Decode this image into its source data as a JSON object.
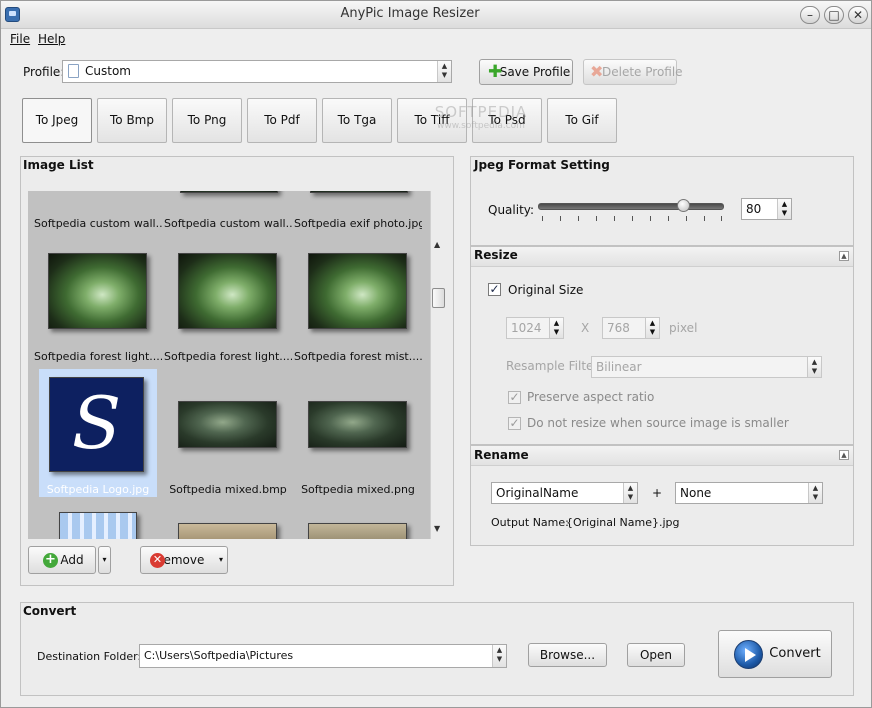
{
  "window": {
    "title": "AnyPic Image Resizer",
    "minimize": "–",
    "maximize": "□",
    "close": "✕"
  },
  "menu": {
    "file": "File",
    "help": "Help"
  },
  "profile": {
    "label": "Profile:",
    "value": "Custom",
    "save_label": "Save Profile",
    "delete_label": "Delete Profile"
  },
  "tabs": [
    "To Jpeg",
    "To Bmp",
    "To Png",
    "To Pdf",
    "To Tga",
    "To Tiff",
    "To Psd",
    "To Gif"
  ],
  "watermark": {
    "main": "SOFTPEDIA",
    "sub": "www.softpedia.com"
  },
  "image_list": {
    "title": "Image List",
    "rows": [
      [
        "Softpedia custom wall...",
        "Softpedia custom wall...",
        "Softpedia exif photo.jpg"
      ],
      [
        "Softpedia forest light....",
        "Softpedia forest light....",
        "Softpedia forest mist...."
      ],
      [
        "Softpedia Logo.jpg",
        "Softpedia mixed.bmp",
        "Softpedia mixed.png"
      ]
    ],
    "logo_letter": "S",
    "add_label": "Add",
    "remove_label": "Remove"
  },
  "jpeg": {
    "title": "Jpeg Format Setting",
    "quality_label": "Quality:",
    "quality_value": "80",
    "quality_fraction": 0.8
  },
  "resize": {
    "title": "Resize",
    "original_size_label": "Original Size",
    "width": "1024",
    "x_label": "X",
    "height": "768",
    "unit": "pixel",
    "filter_label": "Resample Filter:",
    "filter_value": "Bilinear",
    "preserve_label": "Preserve aspect ratio",
    "no_resize_label": "Do not resize when source image is smaller"
  },
  "rename": {
    "title": "Rename",
    "name_value": "OriginalName",
    "plus": "+",
    "suffix_value": "None",
    "output_label": "Output Name:",
    "output_value": "{Original Name}.jpg"
  },
  "convert": {
    "title": "Convert",
    "dest_label": "Destination Folder:",
    "dest_value": "C:\\Users\\Softpedia\\Pictures",
    "browse_label": "Browse...",
    "open_label": "Open",
    "convert_label": "Convert"
  },
  "colors": {
    "accent": "#2f72c4",
    "selection": "#c9defa",
    "logo_bg": "#0d2060"
  }
}
